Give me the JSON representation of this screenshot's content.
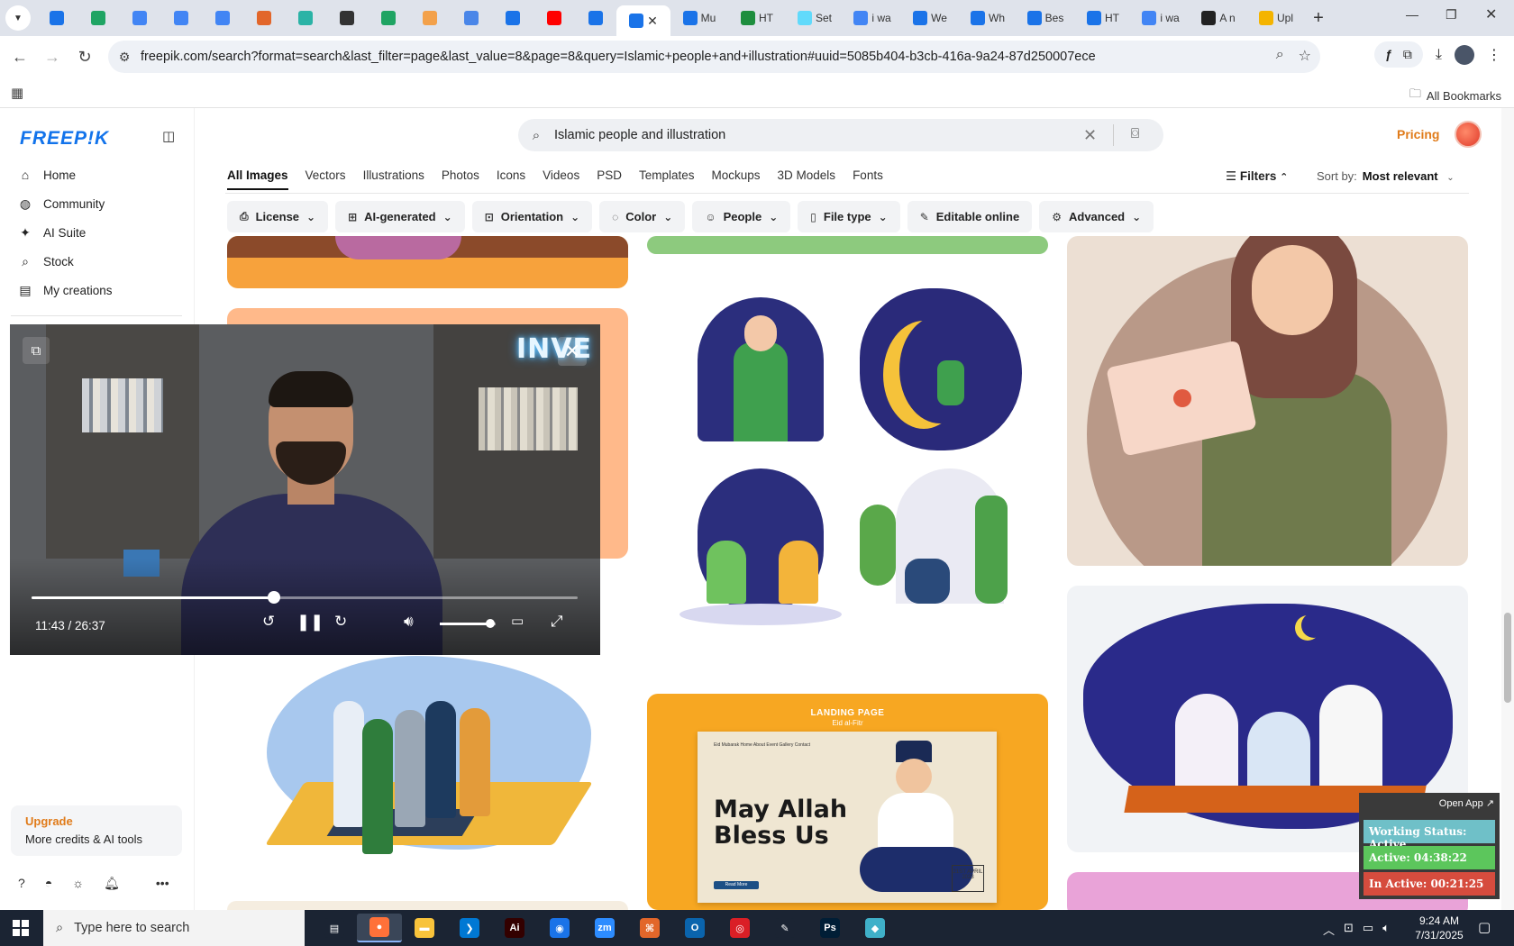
{
  "browser": {
    "tabs": [
      {
        "title": "",
        "icon": "wordpress-icon",
        "color": "#1a73e8"
      },
      {
        "title": "",
        "icon": "sheets-icon",
        "color": "#1fa463"
      },
      {
        "title": "",
        "icon": "docs-icon",
        "color": "#4285f4"
      },
      {
        "title": "",
        "icon": "docs-icon",
        "color": "#4285f4"
      },
      {
        "title": "",
        "icon": "docs-icon",
        "color": "#4285f4"
      },
      {
        "title": "",
        "icon": "html-icon",
        "color": "#e2662a"
      },
      {
        "title": "",
        "icon": "vpn-icon",
        "color": "#2bb3a6"
      },
      {
        "title": "",
        "icon": "openai-icon",
        "color": "#333333"
      },
      {
        "title": "",
        "icon": "sheets-icon",
        "color": "#1fa463"
      },
      {
        "title": "",
        "icon": "hand-icon",
        "color": "#f3a14a"
      },
      {
        "title": "",
        "icon": "grid-icon",
        "color": "#4a86e8"
      },
      {
        "title": "",
        "icon": "forms-icon",
        "color": "#1a73e8"
      },
      {
        "title": "",
        "icon": "youtube-icon",
        "color": "#ff0000"
      },
      {
        "title": "",
        "icon": "forms-icon",
        "color": "#1a73e8"
      },
      {
        "title": "",
        "icon": "forms-icon",
        "color": "#1a73e8",
        "active": true
      },
      {
        "title": "Mu",
        "icon": "forms-icon",
        "color": "#1a73e8"
      },
      {
        "title": "HT",
        "icon": "w-icon",
        "color": "#1e8e3e"
      },
      {
        "title": "Set",
        "icon": "react-icon",
        "color": "#61dafb"
      },
      {
        "title": "i wa",
        "icon": "google-icon",
        "color": "#4285f4"
      },
      {
        "title": "We",
        "icon": "c-icon",
        "color": "#1a73e8"
      },
      {
        "title": "Wh",
        "icon": "c-icon",
        "color": "#1a73e8"
      },
      {
        "title": "Bes",
        "icon": "c-icon",
        "color": "#1a73e8"
      },
      {
        "title": "HT",
        "icon": "c-icon",
        "color": "#1a73e8"
      },
      {
        "title": "i wa",
        "icon": "google-icon",
        "color": "#4285f4"
      },
      {
        "title": "A n",
        "icon": "a-icon",
        "color": "#222222"
      },
      {
        "title": "Upl",
        "icon": "hat-icon",
        "color": "#f4b400"
      }
    ],
    "url": "freepik.com/search?format=search&last_filter=page&last_value=8&page=8&query=Islamic+people+and+illustration#uuid=5085b404-b3cb-416a-9a24-87d250007ece",
    "all_bookmarks": "All Bookmarks"
  },
  "sidebar": {
    "logo": "FREEP!K",
    "items": [
      {
        "label": "Home",
        "icon": "home-icon"
      },
      {
        "label": "Community",
        "icon": "globe-icon"
      },
      {
        "label": "AI Suite",
        "icon": "sparkle-icon"
      },
      {
        "label": "Stock",
        "icon": "search-icon"
      },
      {
        "label": "My creations",
        "icon": "folder-icon"
      }
    ],
    "upgrade_title": "Upgrade",
    "upgrade_sub": "More credits & AI tools"
  },
  "header": {
    "search_value": "Islamic people and illustration",
    "pricing": "Pricing",
    "tabs": [
      "All Images",
      "Vectors",
      "Illustrations",
      "Photos",
      "Icons",
      "Videos",
      "PSD",
      "Templates",
      "Mockups",
      "3D Models",
      "Fonts"
    ],
    "active_tab": "All Images",
    "filters_label": "Filters",
    "sort_label": "Sort by:",
    "sort_value": "Most relevant",
    "filter_chips": [
      {
        "label": "License",
        "icon": "license-icon"
      },
      {
        "label": "AI-generated",
        "icon": "ai-icon"
      },
      {
        "label": "Orientation",
        "icon": "orientation-icon"
      },
      {
        "label": "Color",
        "icon": "palette-icon"
      },
      {
        "label": "People",
        "icon": "people-icon"
      },
      {
        "label": "File type",
        "icon": "file-icon"
      },
      {
        "label": "Editable online",
        "icon": "pen-icon",
        "no_chevron": true
      },
      {
        "label": "Advanced",
        "icon": "gear-icon"
      }
    ]
  },
  "cards": {
    "landing_page_title": "LANDING PAGE",
    "landing_page_sub": "Eid al-Fitr",
    "landing_headline_1": "May Allah",
    "landing_headline_2": "Bless Us",
    "landing_nav": "Eid Mubarak   Home   About   Event   Gallery   Contact",
    "landing_button": "Read More",
    "landing_date": "21ST APRIL 2023"
  },
  "video": {
    "neon_text": "INVE",
    "current_time": "11:43",
    "duration": "26:37",
    "time_display": "11:43 / 26:37",
    "progress": 0.444,
    "volume": 0.9
  },
  "tracker": {
    "open_app": "Open App ↗",
    "working_status": "Working Status: Active",
    "active": "Active: 04:38:22",
    "inactive": "In Active: 00:21:25"
  },
  "taskbar": {
    "search_placeholder": "Type here to search",
    "apps": [
      {
        "icon": "task-view-icon",
        "color": "#1b2433",
        "glyph": "▤"
      },
      {
        "icon": "firefox-icon",
        "color": "#ff7139",
        "glyph": "●",
        "active": true
      },
      {
        "icon": "file-explorer-icon",
        "color": "#f8c33b",
        "glyph": "▬"
      },
      {
        "icon": "vscode-icon",
        "color": "#0078d4",
        "glyph": "❯"
      },
      {
        "icon": "illustrator-icon",
        "color": "#330000",
        "glyph": "Ai"
      },
      {
        "icon": "chrome-icon",
        "color": "#1a73e8",
        "glyph": "◉"
      },
      {
        "icon": "zoom-icon",
        "color": "#2d8cff",
        "glyph": "zm"
      },
      {
        "icon": "html-editor-icon",
        "color": "#e2662a",
        "glyph": "⌘"
      },
      {
        "icon": "outlook-icon",
        "color": "#0a64ad",
        "glyph": "O"
      },
      {
        "icon": "creative-cloud-icon",
        "color": "#da1f26",
        "glyph": "◎"
      },
      {
        "icon": "pen-tool-icon",
        "color": "#1b2433",
        "glyph": "✎"
      },
      {
        "icon": "photoshop-icon",
        "color": "#001e36",
        "glyph": "Ps"
      },
      {
        "icon": "app-icon",
        "color": "#3fb0c9",
        "glyph": "◆"
      }
    ],
    "time": "9:24 AM",
    "date": "7/31/2025"
  }
}
